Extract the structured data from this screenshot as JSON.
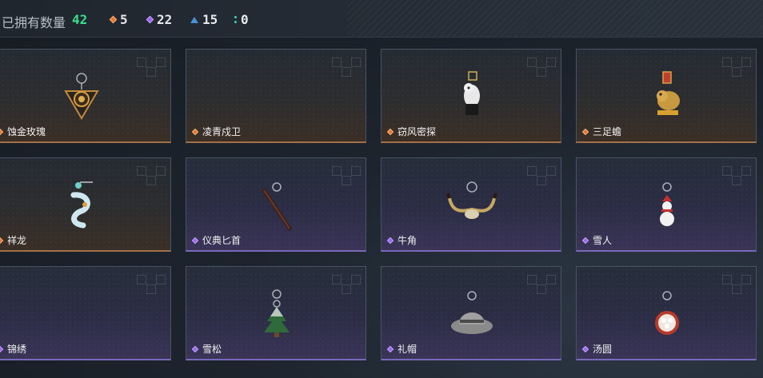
{
  "header": {
    "owned_label": "已拥有数量",
    "owned_count": "42",
    "rarities": [
      {
        "icon": "orange-diamond-icon",
        "color": "#e07a3a",
        "count": "5"
      },
      {
        "icon": "purple-diamond-icon",
        "color": "#9a68e8",
        "count": "22"
      },
      {
        "icon": "blue-triangle-icon",
        "color": "#4a8fd8",
        "count": "15"
      },
      {
        "icon": "teal-dots-icon",
        "color": "#3ed0c0",
        "count": "0"
      }
    ]
  },
  "items": [
    {
      "name": "蚀金玫瑰",
      "rarity": "orange",
      "icon": "gold-rose-charm-icon"
    },
    {
      "name": "凌青戍卫",
      "rarity": "orange",
      "icon": "cyan-guardian-charm-icon"
    },
    {
      "name": "窃风密探",
      "rarity": "orange",
      "icon": "spy-charm-icon"
    },
    {
      "name": "三足蟾",
      "rarity": "orange",
      "icon": "three-legged-toad-charm-icon"
    },
    {
      "name": "祥龙",
      "rarity": "orange",
      "icon": "dragon-charm-icon"
    },
    {
      "name": "仪典匕首",
      "rarity": "purple",
      "icon": "ceremonial-dagger-charm-icon"
    },
    {
      "name": "牛角",
      "rarity": "purple",
      "icon": "horns-charm-icon"
    },
    {
      "name": "雪人",
      "rarity": "purple",
      "icon": "snowman-charm-icon"
    },
    {
      "name": "锦绣",
      "rarity": "purple",
      "icon": "brocade-charm-icon"
    },
    {
      "name": "雪松",
      "rarity": "purple",
      "icon": "snow-pine-charm-icon"
    },
    {
      "name": "礼帽",
      "rarity": "purple",
      "icon": "hat-charm-icon"
    },
    {
      "name": "汤圆",
      "rarity": "purple",
      "icon": "tangyuan-charm-icon"
    }
  ]
}
